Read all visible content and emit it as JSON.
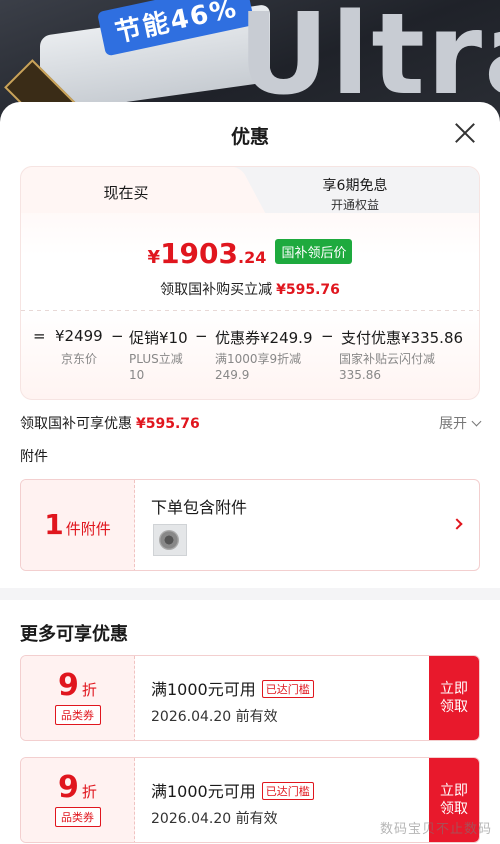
{
  "background": {
    "slogan": "节能46%",
    "product_word": "Ultra"
  },
  "sheet": {
    "title": "优惠"
  },
  "tabs": {
    "active": "现在买",
    "inactive_line1": "享6期免息",
    "inactive_line2": "开通权益"
  },
  "price": {
    "symbol": "¥",
    "integer": "1903",
    "decimal": ".24",
    "tag": "国补领后价",
    "subtitle": "领取国补购买立减",
    "subtitle_amount": "¥595.76"
  },
  "calc": {
    "eq": "=",
    "jd_price": "¥2499",
    "jd_price_label": "京东价",
    "minus1": "−",
    "promo": "促销¥10",
    "promo_sub1": "PLUS立减",
    "promo_sub2": "10",
    "minus2": "−",
    "coupon": "优惠券¥249.9",
    "coupon_sub1": "满1000享9折减",
    "coupon_sub2": "249.9",
    "minus3": "−",
    "pay": "支付优惠¥335.86",
    "pay_sub1": "国家补贴云闪付减",
    "pay_sub2": "335.86"
  },
  "subsidy": {
    "label": "领取国补可享优惠",
    "amount": "¥595.76",
    "expand": "展开"
  },
  "attachments": {
    "section_label": "附件",
    "count": "1",
    "unit": "件附件",
    "title": "下单包含附件"
  },
  "more": {
    "title": "更多可享优惠",
    "coupons": [
      {
        "num": "9",
        "unit": "折",
        "type": "品类券",
        "main": "满1000元可用",
        "badge": "已达门槛",
        "date": "2026.04.20 前有效",
        "btn_line1": "立即",
        "btn_line2": "领取"
      },
      {
        "num": "9",
        "unit": "折",
        "type": "品类券",
        "main": "满1000元可用",
        "badge": "已达门槛",
        "date": "2026.04.20 前有效",
        "btn_line1": "立即",
        "btn_line2": "领取"
      }
    ]
  },
  "watermark": "数码宝贝不止数码",
  "colors": {
    "accent_red": "#e0161e",
    "green_tag": "#1eaa3e",
    "button_red": "#e8192c"
  }
}
